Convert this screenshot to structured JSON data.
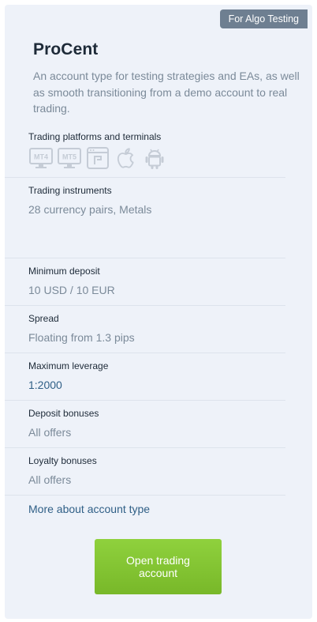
{
  "badge": "For Algo Testing",
  "account": {
    "title": "ProCent",
    "description": "An account type for testing strategies and EAs, as well as smooth transitioning from a demo account to real trading."
  },
  "platforms": {
    "label": "Trading platforms and terminals",
    "items": [
      {
        "icon": "mt4-icon",
        "text": "MT4"
      },
      {
        "icon": "mt5-icon",
        "text": "MT5"
      },
      {
        "icon": "web-terminal-icon",
        "text": ""
      },
      {
        "icon": "apple-icon",
        "text": ""
      },
      {
        "icon": "android-icon",
        "text": ""
      }
    ]
  },
  "instruments": {
    "label": "Trading instruments",
    "value": "28 currency pairs, Metals"
  },
  "min_deposit": {
    "label": "Minimum deposit",
    "value": "10 USD / 10 EUR"
  },
  "spread": {
    "label": "Spread",
    "value": "Floating from 1.3 pips"
  },
  "leverage": {
    "label": "Maximum leverage",
    "value": "1:2000"
  },
  "deposit_bonuses": {
    "label": "Deposit bonuses",
    "value": "All offers"
  },
  "loyalty_bonuses": {
    "label": "Loyalty bonuses",
    "value": "All offers"
  },
  "more_link": "More about account type",
  "cta": "Open trading account",
  "colors": {
    "card_bg": "#eef2f9",
    "badge_bg": "#6e7f91",
    "cta_green": "#84c433",
    "link_blue": "#2f5f86",
    "muted_text": "#7b8a99",
    "icon_gray": "#c5ccd6"
  }
}
